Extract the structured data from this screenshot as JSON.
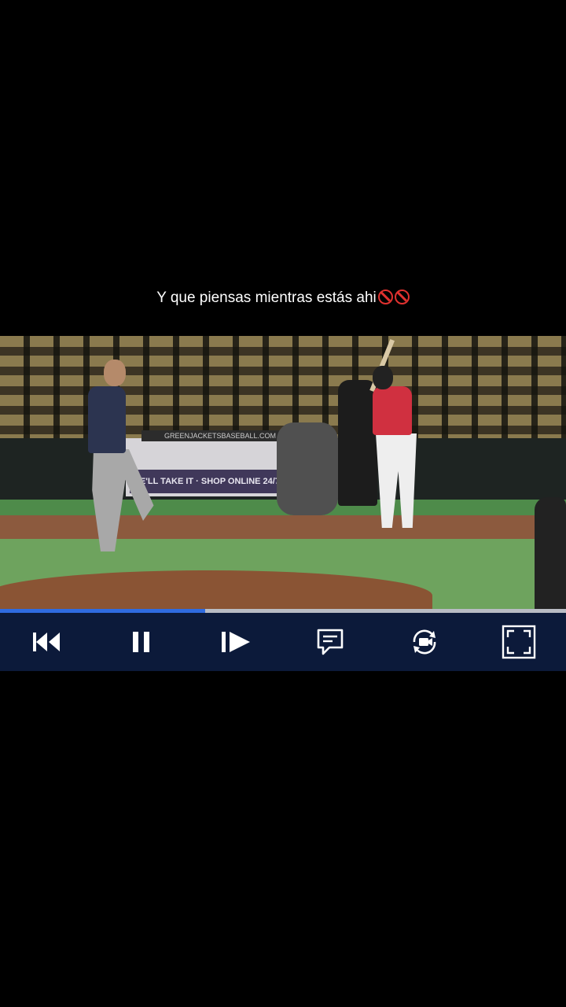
{
  "caption": {
    "text": "Y que piensas mientras estás ahi"
  },
  "video": {
    "banner_top": "GREENJACKETSBASEBALL.COM",
    "banner_text": "WE'LL TAKE IT · SHOP ONLINE 24/7 AT HIVEPROSHOP"
  },
  "player": {
    "progress": 0.363,
    "progress_color": "#2f6be0",
    "controls": [
      {
        "name": "skip-back",
        "icon": "skip-back-icon"
      },
      {
        "name": "pause",
        "icon": "pause-icon"
      },
      {
        "name": "play-next",
        "icon": "play-next-icon"
      },
      {
        "name": "captions",
        "icon": "comment-icon"
      },
      {
        "name": "rotate",
        "icon": "rotate-camera-icon"
      },
      {
        "name": "fullscreen",
        "icon": "fullscreen-icon"
      }
    ],
    "bar_color": "#0c1a3a"
  }
}
